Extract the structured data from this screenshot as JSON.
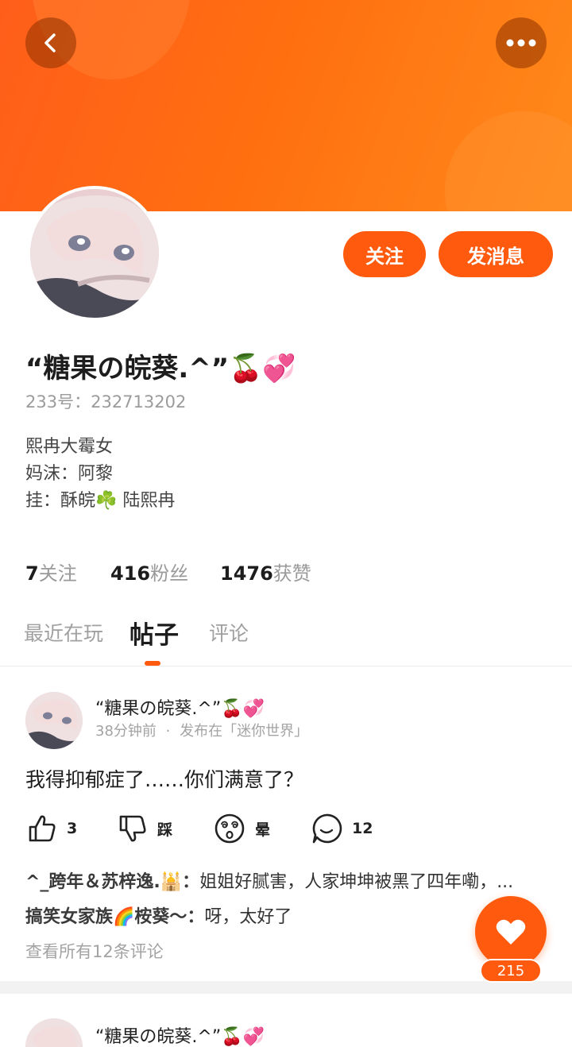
{
  "header": {
    "back_label": "back",
    "more_label": "more"
  },
  "profile": {
    "name": "“糖果の皖葵.^”🍒💞",
    "uid_label": "233号：",
    "uid": "232713202",
    "bio_lines": [
      "熙冉大霉女",
      "妈沫：阿黎",
      "挂：酥皖☘️ 陆熙冉"
    ],
    "follow_button": "关注",
    "message_button": "发消息",
    "stats": [
      {
        "value": "7",
        "label": "关注"
      },
      {
        "value": "416",
        "label": "粉丝"
      },
      {
        "value": "1476",
        "label": "获赞"
      }
    ]
  },
  "tabs": [
    {
      "label": "最近在玩",
      "active": false
    },
    {
      "label": "帖子",
      "active": true
    },
    {
      "label": "评论",
      "active": false
    }
  ],
  "post": {
    "author": "“糖果の皖葵.^”🍒💞",
    "time": "38分钟前",
    "dot": "·",
    "published_in": "发布在「迷你世界」",
    "content": "我得抑郁症了……你们满意了？",
    "actions": [
      {
        "icon": "thumbs-up-icon",
        "label": "3"
      },
      {
        "icon": "thumbs-down-icon",
        "label": "踩"
      },
      {
        "icon": "dizzy-face-icon",
        "label": "晕"
      },
      {
        "icon": "comment-bubble-icon",
        "label": "12"
      }
    ],
    "comments": [
      {
        "user": "^_跨年＆苏梓逸.🕌：",
        "text": "姐姐好腻害，人家坤坤被黑了四年嘞，..."
      },
      {
        "user": "搞笑女家族🌈桉葵～：",
        "text": "呀，太好了"
      }
    ],
    "see_all": "查看所有12条评论"
  },
  "post2": {
    "author": "“糖果の皖葵.^”🍒💞"
  },
  "fab": {
    "icon": "heart-icon",
    "count": "215"
  },
  "colors": {
    "accent": "#ff5a0d",
    "banner_start": "#ff5e1a",
    "banner_end": "#ff8a1a"
  }
}
